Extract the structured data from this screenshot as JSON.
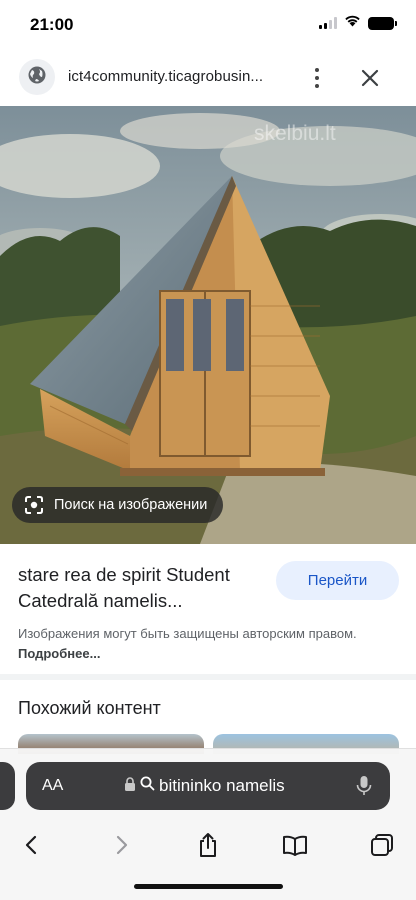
{
  "status_bar": {
    "time": "21:00"
  },
  "header": {
    "url": "ict4community.ticagrobusin...",
    "icons": [
      "globe-icon",
      "more-vert-icon",
      "close-icon"
    ]
  },
  "image": {
    "watermark": "skelbiu.lt",
    "lens_label": "Поиск на изображении"
  },
  "result": {
    "title": "stare rea de spirit Student Catedrală namelis...",
    "go_button": "Перейти",
    "copyright_text": "Изображения могут быть защищены авторским правом.",
    "more_link": "Подробнее..."
  },
  "similar": {
    "heading": "Похожий контент"
  },
  "safari": {
    "aa_label": "AA",
    "search_query": "bitininko namelis",
    "icons": [
      "lock-icon",
      "search-icon",
      "microphone-icon",
      "back-icon",
      "forward-icon",
      "share-icon",
      "bookmarks-icon",
      "tabs-icon"
    ]
  },
  "colors": {
    "accent": "#1a56c7",
    "button_bg": "#e8f0fe",
    "toolbar_dark": "#3c3c3e"
  }
}
